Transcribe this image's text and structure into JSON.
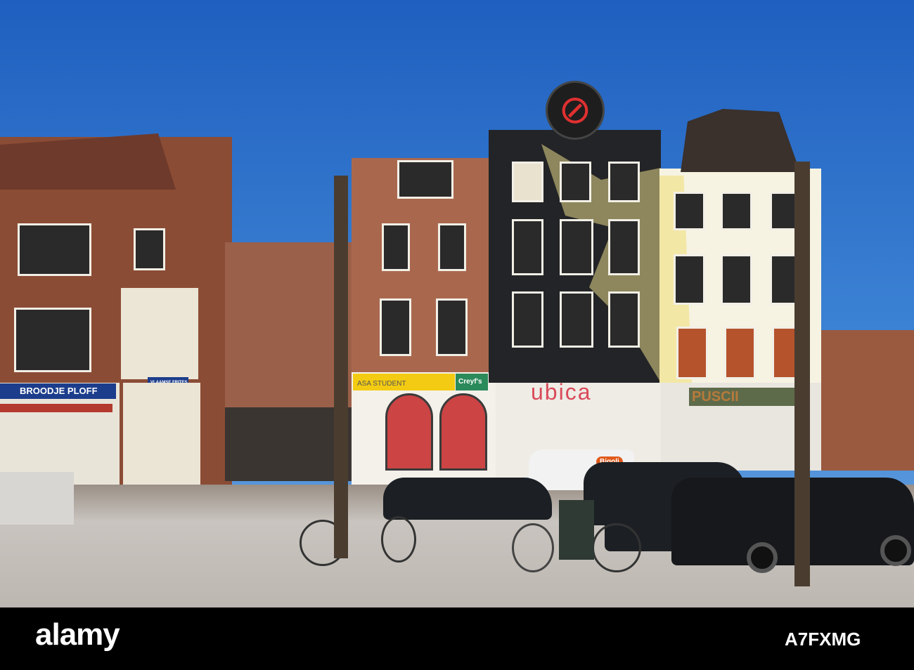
{
  "signs": {
    "ploff": "BROODJE PLOFF",
    "frites": "VLAAMSE FRITES",
    "asa": "ASA STUDENT",
    "creyfs": "Creyf's",
    "ubica": "ubica",
    "puscii": "PUSCII",
    "bigoli": "Bigoli"
  },
  "watermark": {
    "logo": "alamy",
    "image_code": "A7FXMG"
  },
  "colors": {
    "sky": "#2f6fc8",
    "brick": "#8a4a32",
    "black_facade": "#232427",
    "yellow_mural": "#f1e08a"
  }
}
